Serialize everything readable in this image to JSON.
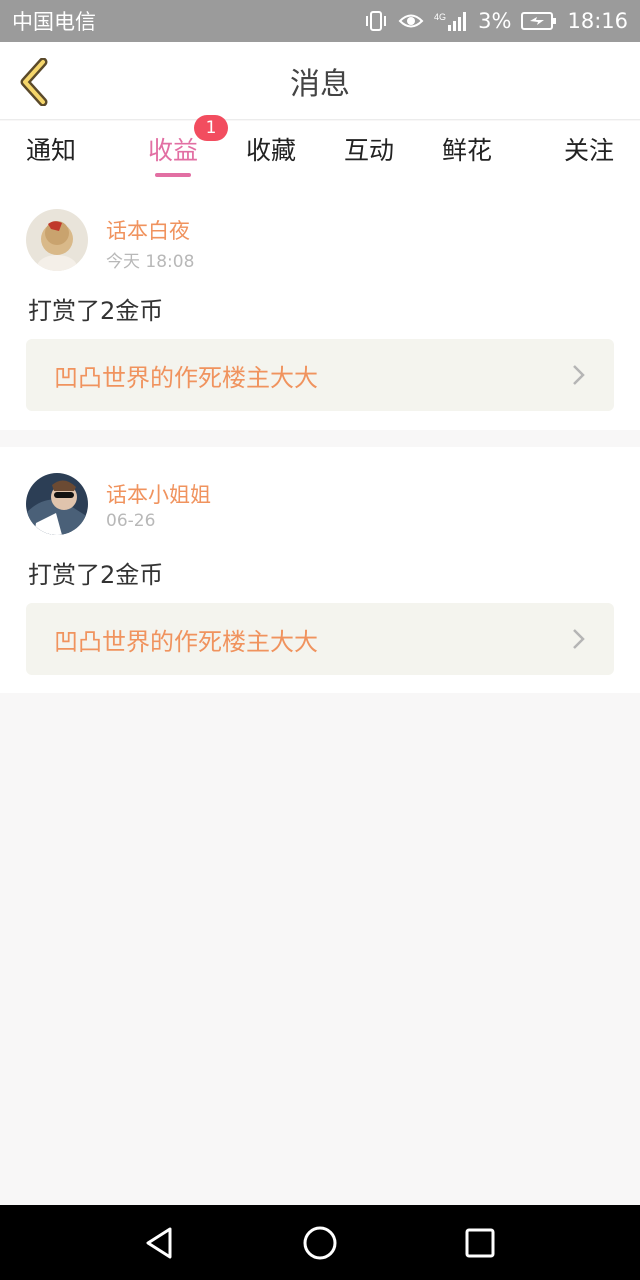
{
  "status_bar": {
    "carrier": "中国电信",
    "battery": "3%",
    "time": "18:16",
    "icons": [
      "vibrate-icon",
      "eye-icon",
      "signal-4g-icon",
      "battery-charging-icon"
    ],
    "network_label": "4G"
  },
  "header": {
    "title": "消息",
    "back_icon": "chevron-left-icon",
    "accent_color": "#e26fa3"
  },
  "tabs": [
    {
      "label": "通知",
      "active": false
    },
    {
      "label": "收益",
      "active": true,
      "badge": "1"
    },
    {
      "label": "收藏",
      "active": false
    },
    {
      "label": "互动",
      "active": false
    },
    {
      "label": "鲜花",
      "active": false
    },
    {
      "label": "关注",
      "active": false
    }
  ],
  "messages": [
    {
      "username": "话本白夜",
      "time": "今天 18:08",
      "text": "打赏了2金币",
      "post_title": "凹凸世界的作死楼主大大",
      "avatar_icon": "avatar-image"
    },
    {
      "username": "话本小姐姐",
      "time": "06-26",
      "text": "打赏了2金币",
      "post_title": "凹凸世界的作死楼主大大",
      "avatar_icon": "avatar-image"
    }
  ],
  "nav_bar": {
    "icons": [
      "back-triangle-icon",
      "home-circle-icon",
      "recents-square-icon"
    ]
  }
}
